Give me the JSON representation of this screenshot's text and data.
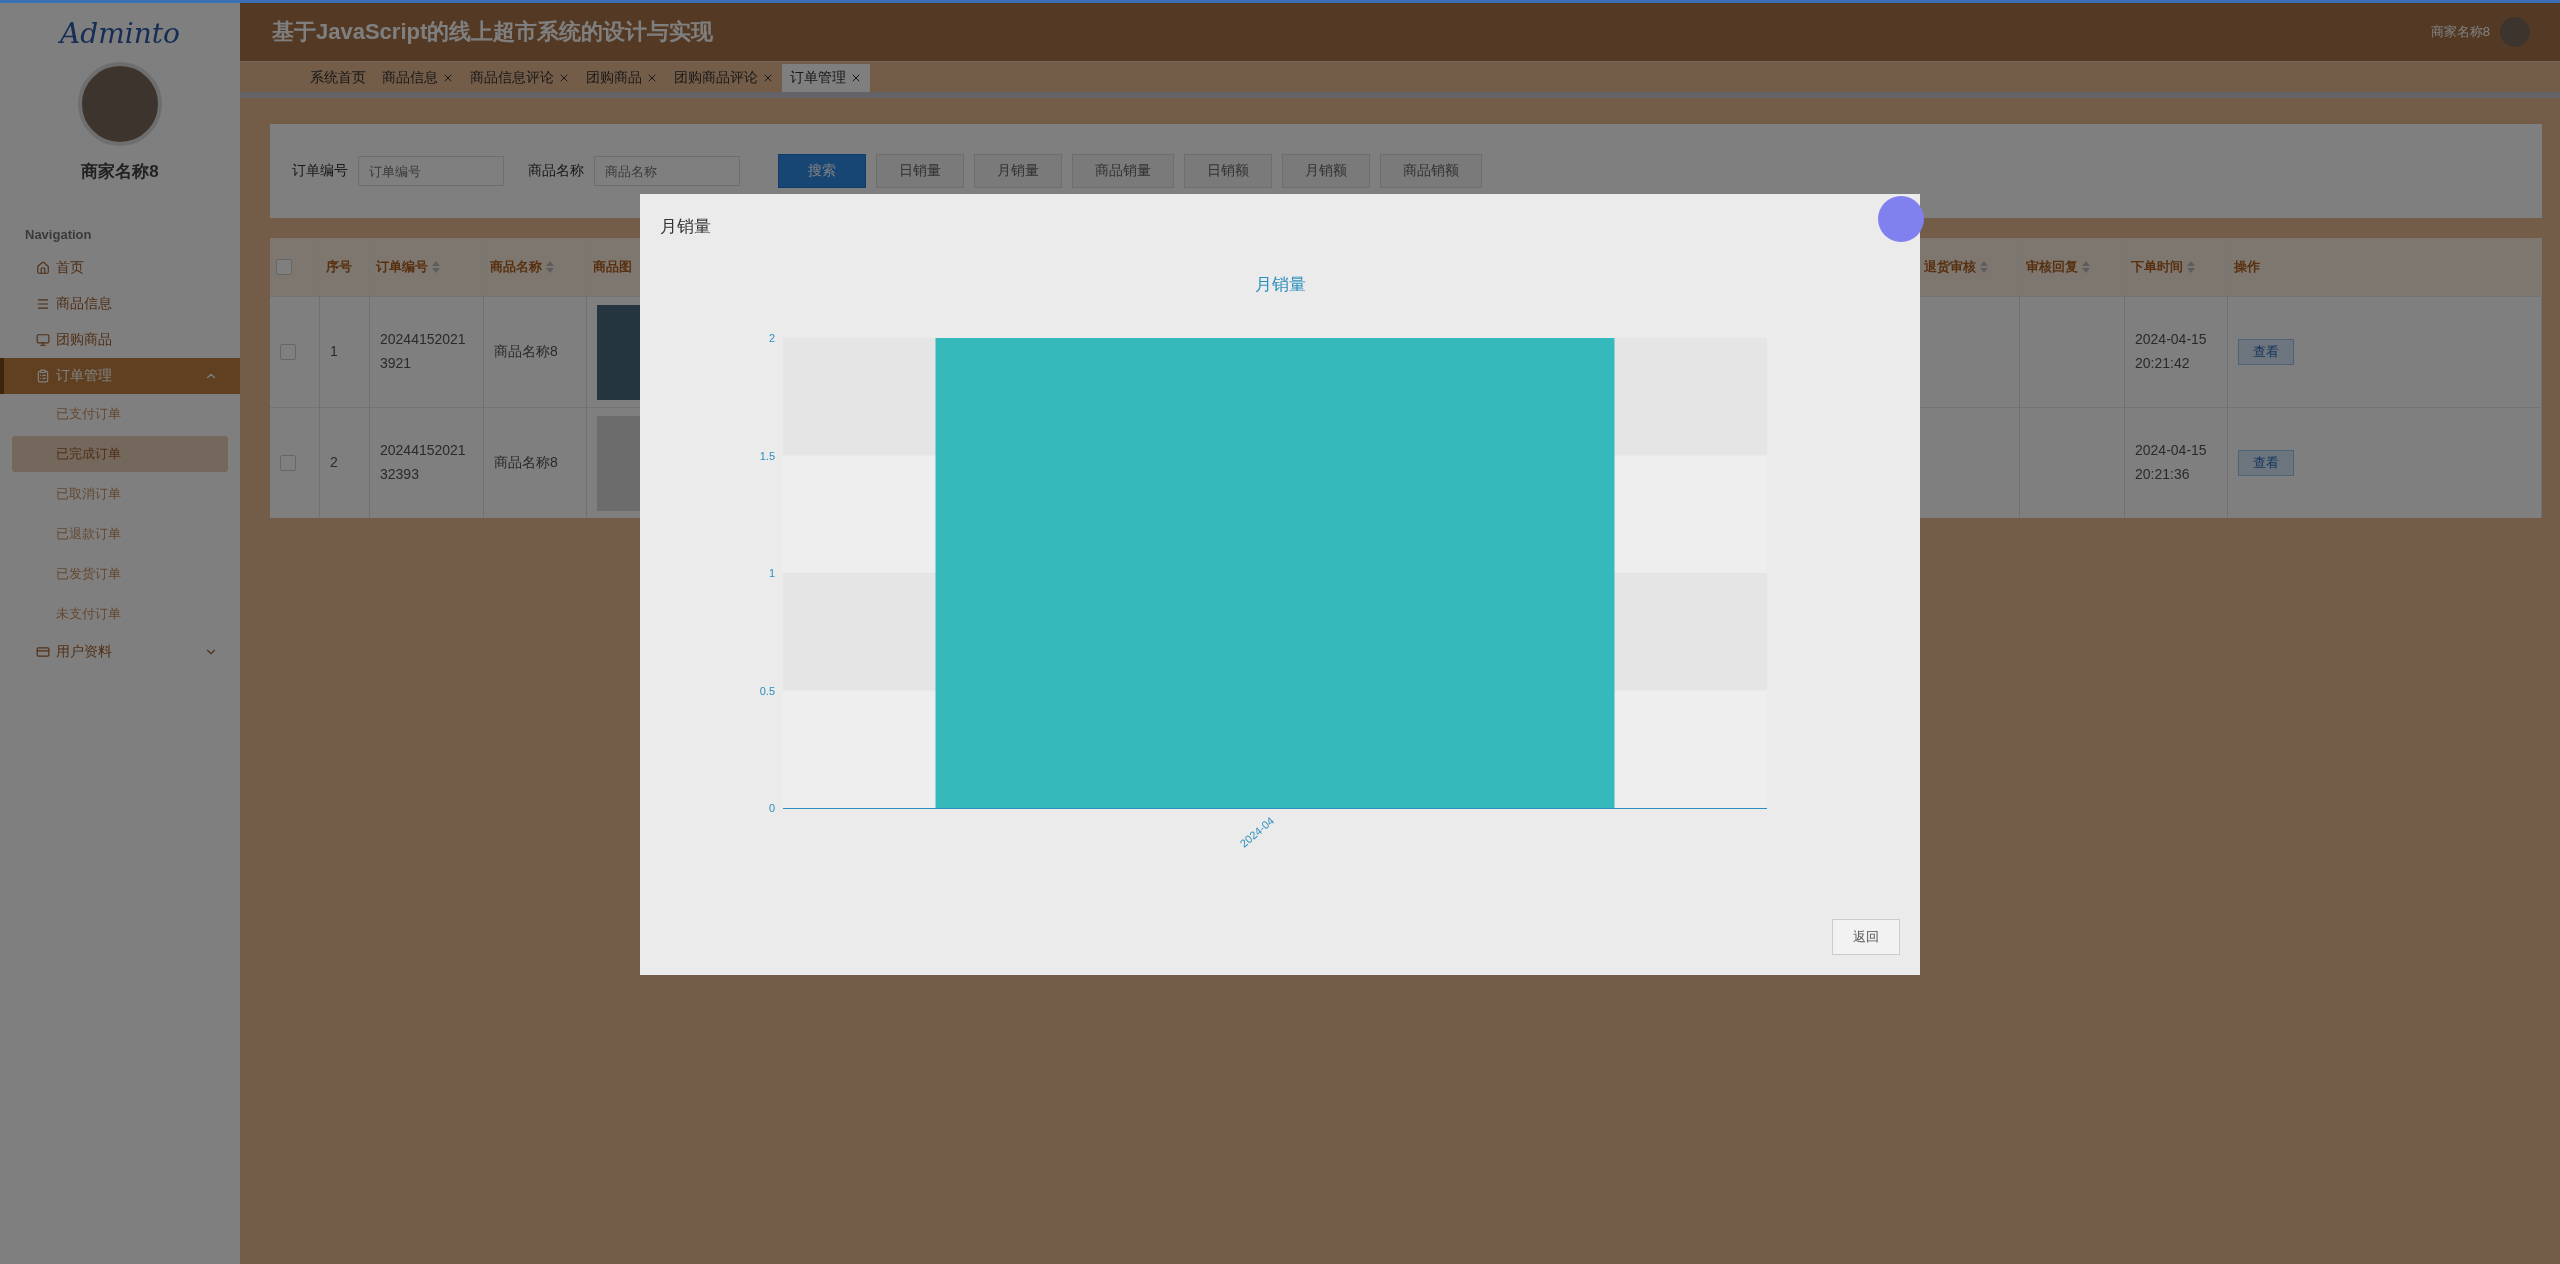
{
  "sidebar": {
    "logo": "Adminto",
    "user_name": "商家名称8",
    "section_label": "Navigation",
    "items": [
      {
        "label": "首页",
        "selected": false
      },
      {
        "label": "商品信息",
        "selected": false
      },
      {
        "label": "团购商品",
        "selected": false
      },
      {
        "label": "订单管理",
        "selected": true,
        "expanded": true,
        "children": [
          {
            "label": "已支付订单",
            "selected": false
          },
          {
            "label": "已完成订单",
            "selected": true
          },
          {
            "label": "已取消订单",
            "selected": false
          },
          {
            "label": "已退款订单",
            "selected": false
          },
          {
            "label": "已发货订单",
            "selected": false
          },
          {
            "label": "未支付订单",
            "selected": false
          }
        ]
      },
      {
        "label": "用户资料",
        "selected": false,
        "expanded": false
      }
    ]
  },
  "header": {
    "title": "基于JavaScript的线上超市系统的设计与实现",
    "user_name": "商家名称8"
  },
  "tabs": [
    {
      "label": "系统首页",
      "closable": false,
      "selected": false
    },
    {
      "label": "商品信息",
      "closable": true,
      "selected": false
    },
    {
      "label": "商品信息评论",
      "closable": true,
      "selected": false
    },
    {
      "label": "团购商品",
      "closable": true,
      "selected": false
    },
    {
      "label": "团购商品评论",
      "closable": true,
      "selected": false
    },
    {
      "label": "订单管理",
      "closable": true,
      "selected": true
    }
  ],
  "search": {
    "fields": [
      {
        "label": "订单编号",
        "placeholder": "订单编号"
      },
      {
        "label": "商品名称",
        "placeholder": "商品名称"
      }
    ],
    "buttons": [
      {
        "label": "搜索",
        "kind": "primary"
      },
      {
        "label": "日销量",
        "kind": "default"
      },
      {
        "label": "月销量",
        "kind": "default"
      },
      {
        "label": "商品销量",
        "kind": "default"
      },
      {
        "label": "日销额",
        "kind": "default"
      },
      {
        "label": "月销额",
        "kind": "default"
      },
      {
        "label": "商品销额",
        "kind": "default"
      }
    ]
  },
  "table": {
    "header_checked": false,
    "columns_left": [
      {
        "label": "序号",
        "sortable": false
      },
      {
        "label": "订单编号",
        "sortable": true
      },
      {
        "label": "商品名称",
        "sortable": true
      },
      {
        "label": "商品图"
      }
    ],
    "columns_right": [
      {
        "label": "退货审核",
        "sortable": true
      },
      {
        "label": "审核回复",
        "sortable": true
      },
      {
        "label": "下单时间",
        "sortable": true
      },
      {
        "label": "操作",
        "sortable": false
      }
    ],
    "rows": [
      {
        "checked": false,
        "index": "1",
        "order_no": "202441520213921",
        "product": "商品名称8",
        "time": "2024-04-15 20:21:42",
        "action": "查看"
      },
      {
        "checked": false,
        "index": "2",
        "order_no": "2024415202132393",
        "product": "商品名称8",
        "time": "2024-04-15 20:21:36",
        "action": "查看"
      }
    ]
  },
  "modal": {
    "title": "月销量",
    "back_button": "返回",
    "chart_data": {
      "type": "bar",
      "title": "月销量",
      "categories": [
        "2024-04"
      ],
      "series": [
        {
          "color": "#36b9bb",
          "values": [
            2
          ]
        }
      ],
      "ylim": [
        0,
        2
      ],
      "yticks": [
        0,
        0.5,
        1,
        1.5,
        2
      ]
    }
  }
}
